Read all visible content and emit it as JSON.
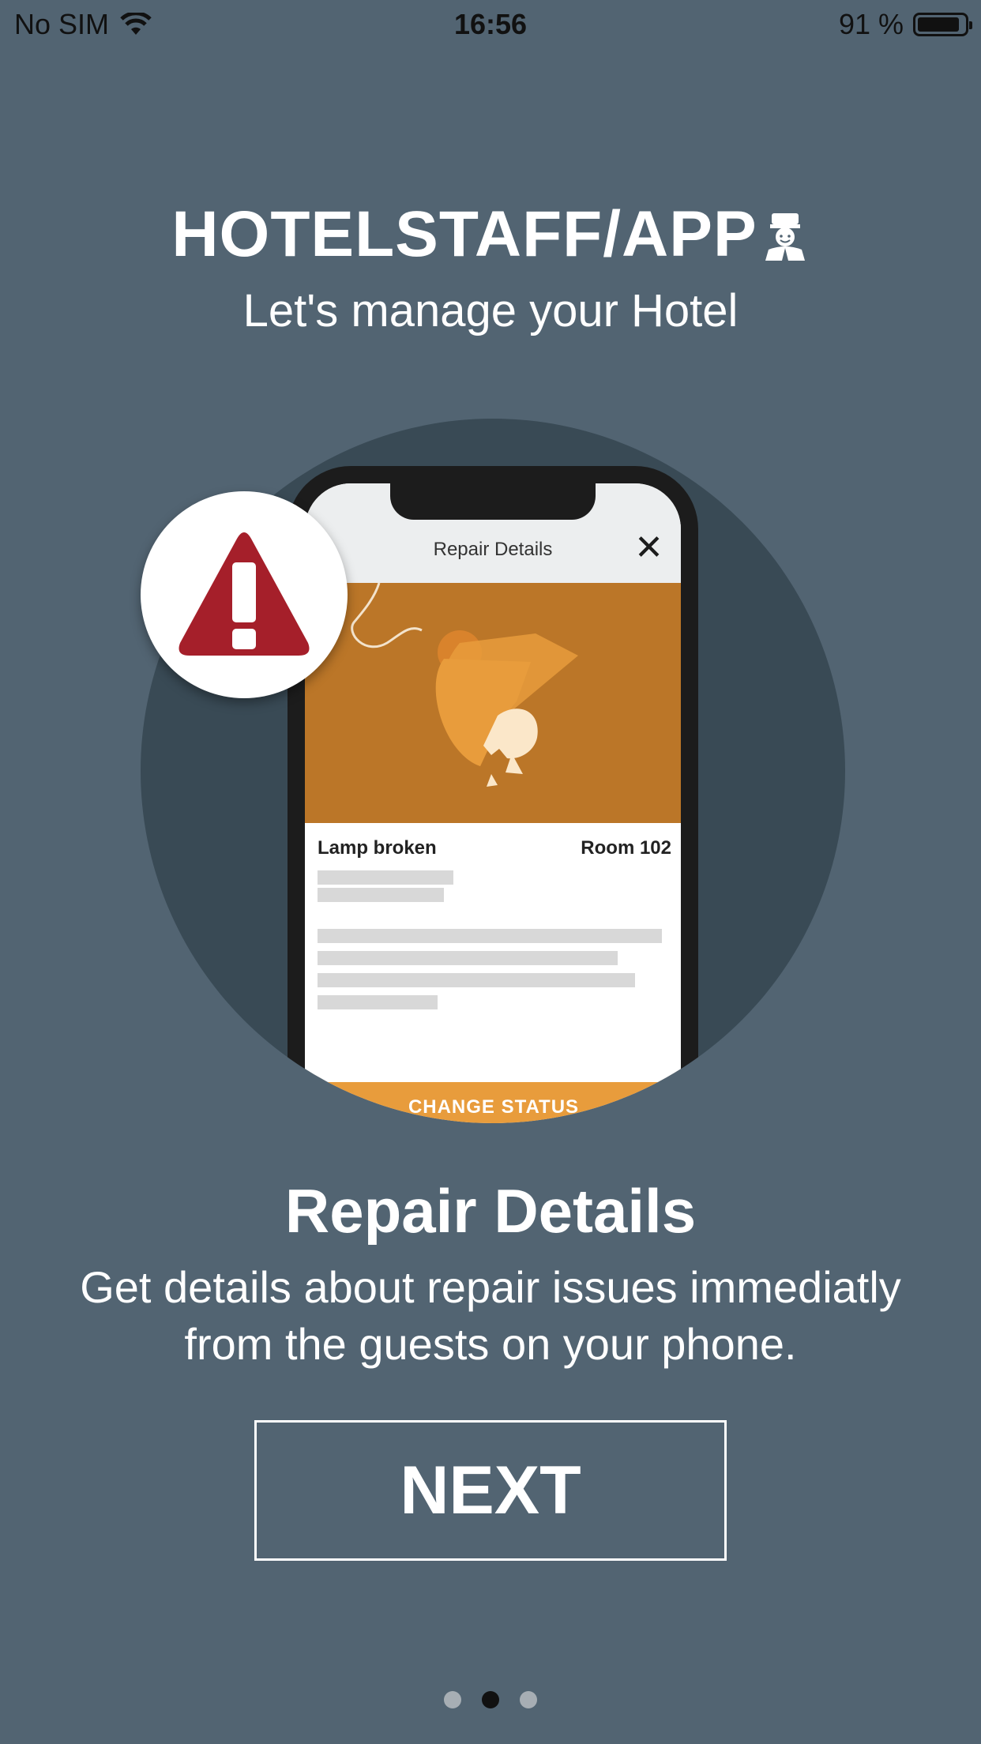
{
  "status_bar": {
    "carrier": "No SIM",
    "time": "16:56",
    "battery_percent": "91 %",
    "battery_level": 0.91
  },
  "header": {
    "app_title": "HOTELSTAFF/APP",
    "tagline": "Let's manage your Hotel"
  },
  "illustration": {
    "screen_title": "Repair Details",
    "issue_name": "Lamp broken",
    "room": "Room 102",
    "action_label": "CHANGE STATUS",
    "icons": [
      "alert-icon",
      "close-icon",
      "broken-lamp-icon"
    ]
  },
  "feature": {
    "title": "Repair Details",
    "description": "Get details about repair issues immediatly from the guests on your phone."
  },
  "next_button": {
    "label": "NEXT"
  },
  "pagination": {
    "total": 3,
    "active_index": 1
  },
  "colors": {
    "background": "#526472",
    "circle": "#394a55",
    "hero": "#bb7628",
    "accent": "#e89c3c",
    "alert": "#a51f2a"
  }
}
